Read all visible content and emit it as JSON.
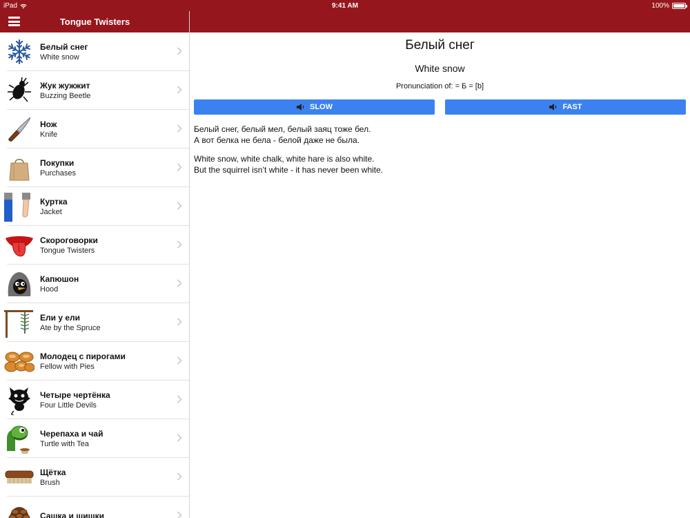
{
  "status": {
    "device": "iPad",
    "time": "9:41 AM",
    "battery": "100%",
    "battery_level": 1.0
  },
  "nav": {
    "title": "Tongue Twisters"
  },
  "items": [
    {
      "ru": "Белый снег",
      "en": "White snow",
      "icon": "snowflake-icon"
    },
    {
      "ru": "Жук жужжит",
      "en": "Buzzing Beetle",
      "icon": "beetle-icon"
    },
    {
      "ru": "Нож",
      "en": "Knife",
      "icon": "knife-icon"
    },
    {
      "ru": "Покупки",
      "en": "Purchases",
      "icon": "shopping-bag-icon"
    },
    {
      "ru": "Куртка",
      "en": "Jacket",
      "icon": "jacket-icon"
    },
    {
      "ru": "Скороговорки",
      "en": "Tongue Twisters",
      "icon": "tongue-icon"
    },
    {
      "ru": "Капюшон",
      "en": "Hood",
      "icon": "hooded-bird-icon"
    },
    {
      "ru": "Ели у ели",
      "en": "Ate by the Spruce",
      "icon": "spruce-icon"
    },
    {
      "ru": "Молодец с пирогами",
      "en": "Fellow with Pies",
      "icon": "pies-icon"
    },
    {
      "ru": "Четыре чертёнка",
      "en": "Four Little Devils",
      "icon": "devil-icon"
    },
    {
      "ru": "Черепаха и чай",
      "en": "Turtle with Tea",
      "icon": "turtle-icon"
    },
    {
      "ru": "Щётка",
      "en": "Brush",
      "icon": "brush-icon"
    },
    {
      "ru": "Сашка и шишки",
      "en": "",
      "icon": "pinecone-icon"
    }
  ],
  "detail": {
    "title": "Белый снег",
    "subtitle": "White snow",
    "pronunciation": "Pronunciation of: = Б = [b]",
    "slow_label": "SLOW",
    "fast_label": "FAST",
    "ru_line1": "Белый снег, белый мел, белый заяц тоже бел.",
    "ru_line2": "А вот белка не бела - белой даже не была.",
    "en_line1": "White snow, white chalk, white hare is also white.",
    "en_line2": "But the squirrel isn’t white - it has never been white."
  },
  "colors": {
    "nav_bar": "#95161c",
    "button": "#3b82f0"
  }
}
